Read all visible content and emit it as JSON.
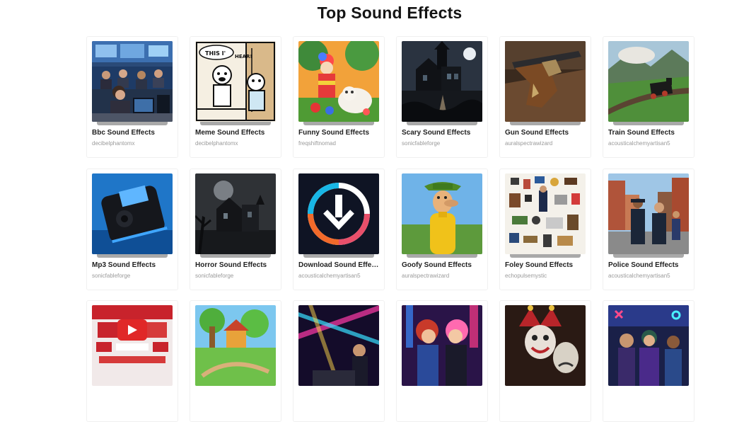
{
  "page": {
    "title": "Top Sound Effects"
  },
  "rows": [
    [
      {
        "title": "Bbc Sound Effects",
        "author": "decibelphantomx"
      },
      {
        "title": "Meme Sound Effects",
        "author": "decibelphantomx"
      },
      {
        "title": "Funny Sound Effects",
        "author": "freqshiftnomad"
      },
      {
        "title": "Scary Sound Effects",
        "author": "sonicfableforge"
      },
      {
        "title": "Gun Sound Effects",
        "author": "auralspectrawizard"
      },
      {
        "title": "Train Sound Effects",
        "author": "acousticalchemyartisan5"
      }
    ],
    [
      {
        "title": "Mp3 Sound Effects",
        "author": "sonicfableforge"
      },
      {
        "title": "Horror Sound Effects",
        "author": "sonicfableforge"
      },
      {
        "title": "Download Sound Effects",
        "author": "acousticalchemyartisan5"
      },
      {
        "title": "Goofy Sound Effects",
        "author": "auralspectrawizard"
      },
      {
        "title": "Foley Sound Effects",
        "author": "echopulsemystic"
      },
      {
        "title": "Police Sound Effects",
        "author": "acousticalchemyartisan5"
      }
    ],
    [
      {
        "title": "",
        "author": ""
      },
      {
        "title": "",
        "author": ""
      },
      {
        "title": "",
        "author": ""
      },
      {
        "title": "",
        "author": ""
      },
      {
        "title": "",
        "author": ""
      },
      {
        "title": "",
        "author": ""
      }
    ]
  ]
}
